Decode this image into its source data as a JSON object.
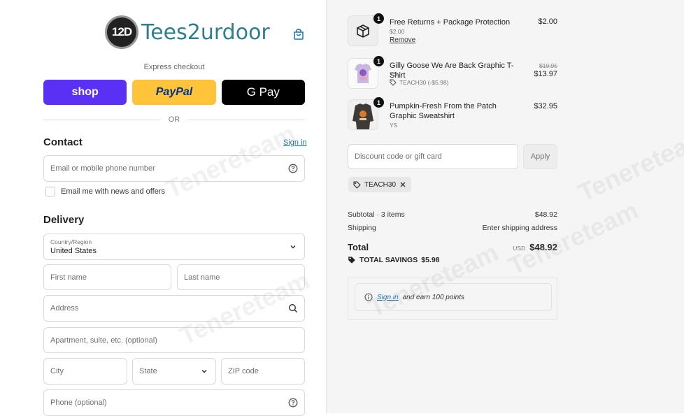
{
  "header": {
    "logo_badge": "12D",
    "logo_text": "Tees2urdoor",
    "cart_icon": "shopping-bag-icon"
  },
  "express": {
    "label": "Express checkout",
    "shop_label": "shop",
    "paypal_label": "PayPal",
    "gpay_label": "G Pay",
    "or_label": "OR"
  },
  "contact": {
    "title": "Contact",
    "sign_in": "Sign in",
    "email_placeholder": "Email or mobile phone number",
    "newsletter_label": "Email me with news and offers"
  },
  "delivery": {
    "title": "Delivery",
    "country_label": "Country/Region",
    "country_value": "United States",
    "first_name": "First name",
    "last_name": "Last name",
    "address": "Address",
    "apartment": "Apartment, suite, etc. (optional)",
    "city": "City",
    "state": "State",
    "zip": "ZIP code",
    "phone": "Phone (optional)"
  },
  "order": {
    "items": [
      {
        "qty": "1",
        "title": "Free Returns + Package Protection",
        "sub": "$2.00",
        "action": "Remove",
        "price": "$2.00"
      },
      {
        "qty": "1",
        "title": "Gilly Goose We Are Back Graphic T-Shirt",
        "sub": "YS",
        "discount": "TEACH30 (-$5.98)",
        "original_price": "$19.95",
        "price": "$13.97"
      },
      {
        "qty": "1",
        "title": "Pumpkin-Fresh From the Patch Graphic Sweatshirt",
        "sub": "YS",
        "price": "$32.95"
      }
    ],
    "discount_placeholder": "Discount code or gift card",
    "apply_label": "Apply",
    "applied_code": "TEACH30",
    "subtotal_label": "Subtotal · 3 items",
    "subtotal_value": "$48.92",
    "shipping_label": "Shipping",
    "shipping_value": "Enter shipping address",
    "total_label": "Total",
    "total_currency": "USD",
    "total_value": "$48.92",
    "savings_label": "TOTAL SAVINGS",
    "savings_value": "$5.98",
    "points_sign_in": "Sign in",
    "points_text": "and earn 100 points"
  },
  "watermark": "Tenereteam",
  "colors": {
    "shop": "#5a31f4",
    "paypal": "#ffc439",
    "gpay": "#000000",
    "link": "#1a73a8",
    "logo": "#2f7f8a"
  }
}
